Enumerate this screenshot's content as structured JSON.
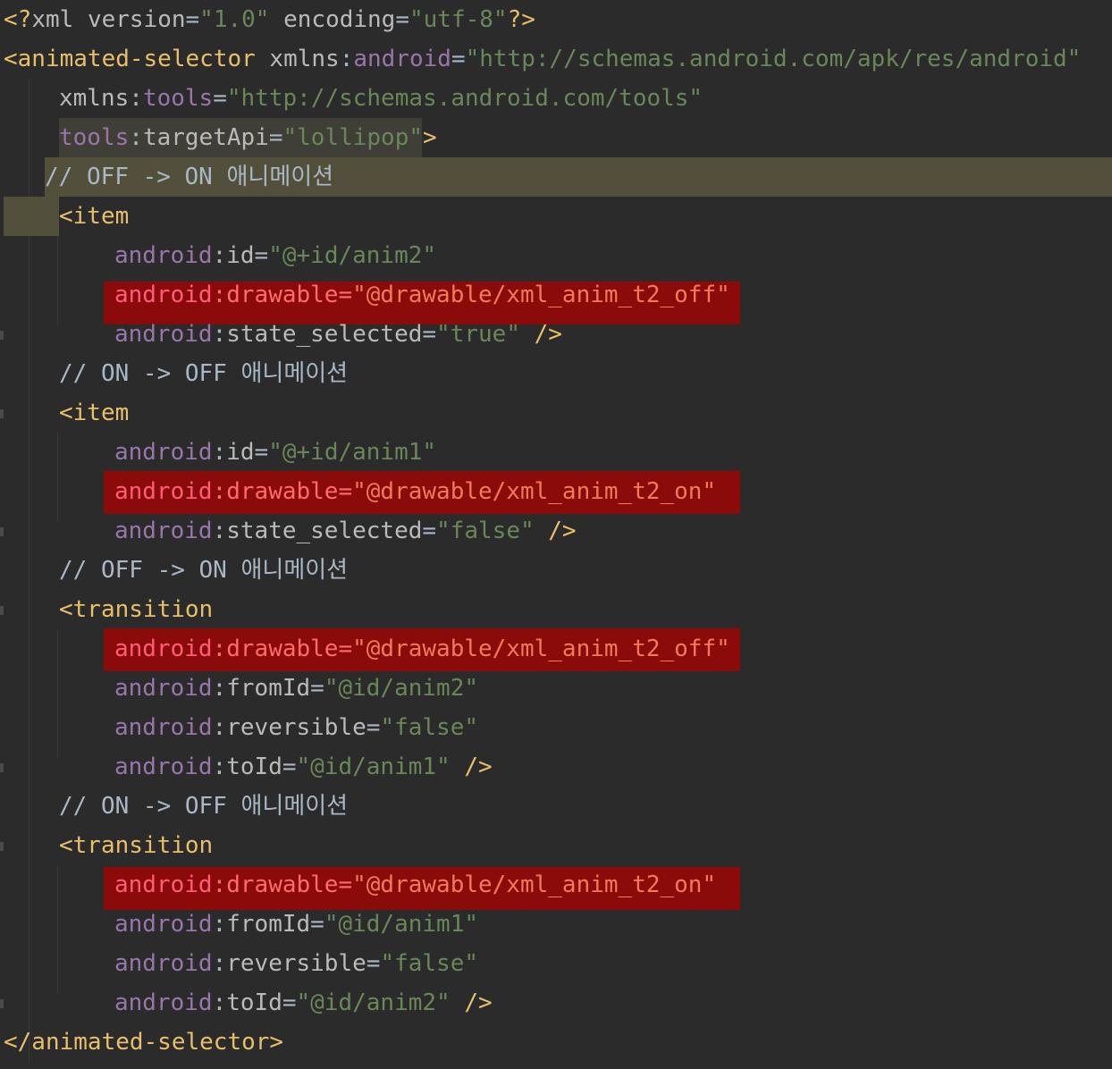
{
  "editor": {
    "lines": [
      {
        "tokens": [
          [
            "tag",
            "<?"
          ],
          [
            "attr",
            "xml "
          ],
          [
            "attr",
            "version"
          ],
          [
            "plain",
            "="
          ],
          [
            "val",
            "\"1.0\""
          ],
          [
            "plain",
            " "
          ],
          [
            "attr",
            "encoding"
          ],
          [
            "plain",
            "="
          ],
          [
            "val",
            "\"utf-8\""
          ],
          [
            "tag",
            "?>"
          ]
        ]
      },
      {
        "tokens": [
          [
            "tag",
            "<animated-selector "
          ],
          [
            "attr",
            "xmlns"
          ],
          [
            "plain",
            ":"
          ],
          [
            "ns",
            "android"
          ],
          [
            "plain",
            "="
          ],
          [
            "val",
            "\"http://schemas.android.com/apk/res/android\""
          ]
        ]
      },
      {
        "tokens": [
          [
            "attr",
            "xmlns"
          ],
          [
            "plain",
            ":"
          ],
          [
            "ns",
            "tools"
          ],
          [
            "plain",
            "="
          ],
          [
            "val",
            "\"http://schemas.android.com/tools\""
          ]
        ]
      },
      {
        "tokens": [
          [
            "ns",
            "tools"
          ],
          [
            "plain",
            ":"
          ],
          [
            "attr",
            "targetApi"
          ],
          [
            "plain",
            "="
          ],
          [
            "val",
            "\"lollipop\""
          ],
          [
            "tag",
            ">"
          ]
        ]
      },
      {
        "tokens": [
          [
            "cmt",
            "// OFF -> ON 애니메이션"
          ]
        ]
      },
      {
        "tokens": [
          [
            "tag",
            "<item"
          ]
        ]
      },
      {
        "tokens": [
          [
            "ns",
            "android"
          ],
          [
            "plain",
            ":"
          ],
          [
            "attr",
            "id"
          ],
          [
            "plain",
            "="
          ],
          [
            "val",
            "\"@+id/anim2\""
          ]
        ]
      },
      {
        "tokens": [
          [
            "ns",
            "android"
          ],
          [
            "plain",
            ":"
          ],
          [
            "attr",
            "drawable"
          ],
          [
            "plain",
            "="
          ],
          [
            "val",
            "\"@drawable/xml_anim_t2_off\""
          ]
        ]
      },
      {
        "tokens": [
          [
            "ns",
            "android"
          ],
          [
            "plain",
            ":"
          ],
          [
            "attr",
            "state_selected"
          ],
          [
            "plain",
            "="
          ],
          [
            "val",
            "\"true\""
          ],
          [
            "plain",
            " "
          ],
          [
            "tag",
            "/>"
          ]
        ]
      },
      {
        "tokens": [
          [
            "cmt",
            "// ON -> OFF 애니메이션"
          ]
        ]
      },
      {
        "tokens": [
          [
            "tag",
            "<item"
          ]
        ]
      },
      {
        "tokens": [
          [
            "ns",
            "android"
          ],
          [
            "plain",
            ":"
          ],
          [
            "attr",
            "id"
          ],
          [
            "plain",
            "="
          ],
          [
            "val",
            "\"@+id/anim1\""
          ]
        ]
      },
      {
        "tokens": [
          [
            "ns",
            "android"
          ],
          [
            "plain",
            ":"
          ],
          [
            "attr",
            "drawable"
          ],
          [
            "plain",
            "="
          ],
          [
            "val",
            "\"@drawable/xml_anim_t2_on\""
          ]
        ]
      },
      {
        "tokens": [
          [
            "ns",
            "android"
          ],
          [
            "plain",
            ":"
          ],
          [
            "attr",
            "state_selected"
          ],
          [
            "plain",
            "="
          ],
          [
            "val",
            "\"false\""
          ],
          [
            "plain",
            " "
          ],
          [
            "tag",
            "/>"
          ]
        ]
      },
      {
        "tokens": [
          [
            "cmt",
            "// OFF -> ON 애니메이션"
          ]
        ]
      },
      {
        "tokens": [
          [
            "tag",
            "<transition"
          ]
        ]
      },
      {
        "tokens": [
          [
            "ns",
            "android"
          ],
          [
            "plain",
            ":"
          ],
          [
            "attr",
            "drawable"
          ],
          [
            "plain",
            "="
          ],
          [
            "val",
            "\"@drawable/xml_anim_t2_off\""
          ]
        ]
      },
      {
        "tokens": [
          [
            "ns",
            "android"
          ],
          [
            "plain",
            ":"
          ],
          [
            "attr",
            "fromId"
          ],
          [
            "plain",
            "="
          ],
          [
            "val",
            "\"@id/anim2\""
          ]
        ]
      },
      {
        "tokens": [
          [
            "ns",
            "android"
          ],
          [
            "plain",
            ":"
          ],
          [
            "attr",
            "reversible"
          ],
          [
            "plain",
            "="
          ],
          [
            "val",
            "\"false\""
          ]
        ]
      },
      {
        "tokens": [
          [
            "ns",
            "android"
          ],
          [
            "plain",
            ":"
          ],
          [
            "attr",
            "toId"
          ],
          [
            "plain",
            "="
          ],
          [
            "val",
            "\"@id/anim1\""
          ],
          [
            "plain",
            " "
          ],
          [
            "tag",
            "/>"
          ]
        ]
      },
      {
        "tokens": [
          [
            "cmt",
            "// ON -> OFF 애니메이션"
          ]
        ]
      },
      {
        "tokens": [
          [
            "tag",
            "<transition"
          ]
        ]
      },
      {
        "tokens": [
          [
            "ns",
            "android"
          ],
          [
            "plain",
            ":"
          ],
          [
            "attr",
            "drawable"
          ],
          [
            "plain",
            "="
          ],
          [
            "val",
            "\"@drawable/xml_anim_t2_on\""
          ]
        ]
      },
      {
        "tokens": [
          [
            "ns",
            "android"
          ],
          [
            "plain",
            ":"
          ],
          [
            "attr",
            "fromId"
          ],
          [
            "plain",
            "="
          ],
          [
            "val",
            "\"@id/anim1\""
          ]
        ]
      },
      {
        "tokens": [
          [
            "ns",
            "android"
          ],
          [
            "plain",
            ":"
          ],
          [
            "attr",
            "reversible"
          ],
          [
            "plain",
            "="
          ],
          [
            "val",
            "\"false\""
          ]
        ]
      },
      {
        "tokens": [
          [
            "ns",
            "android"
          ],
          [
            "plain",
            ":"
          ],
          [
            "attr",
            "toId"
          ],
          [
            "plain",
            "="
          ],
          [
            "val",
            "\"@id/anim2\""
          ],
          [
            "plain",
            " "
          ],
          [
            "tag",
            "/>"
          ]
        ]
      },
      {
        "tokens": [
          [
            "tag",
            "</animated-selector>"
          ]
        ]
      }
    ]
  },
  "colors": {
    "background": "#2b2b2b",
    "tag": "#e8bf6a",
    "namespace": "#9876aa",
    "value": "#6a8759",
    "text": "#a9b7c6",
    "error_highlight": "#8b0b0b",
    "current_line": "#52503a"
  }
}
